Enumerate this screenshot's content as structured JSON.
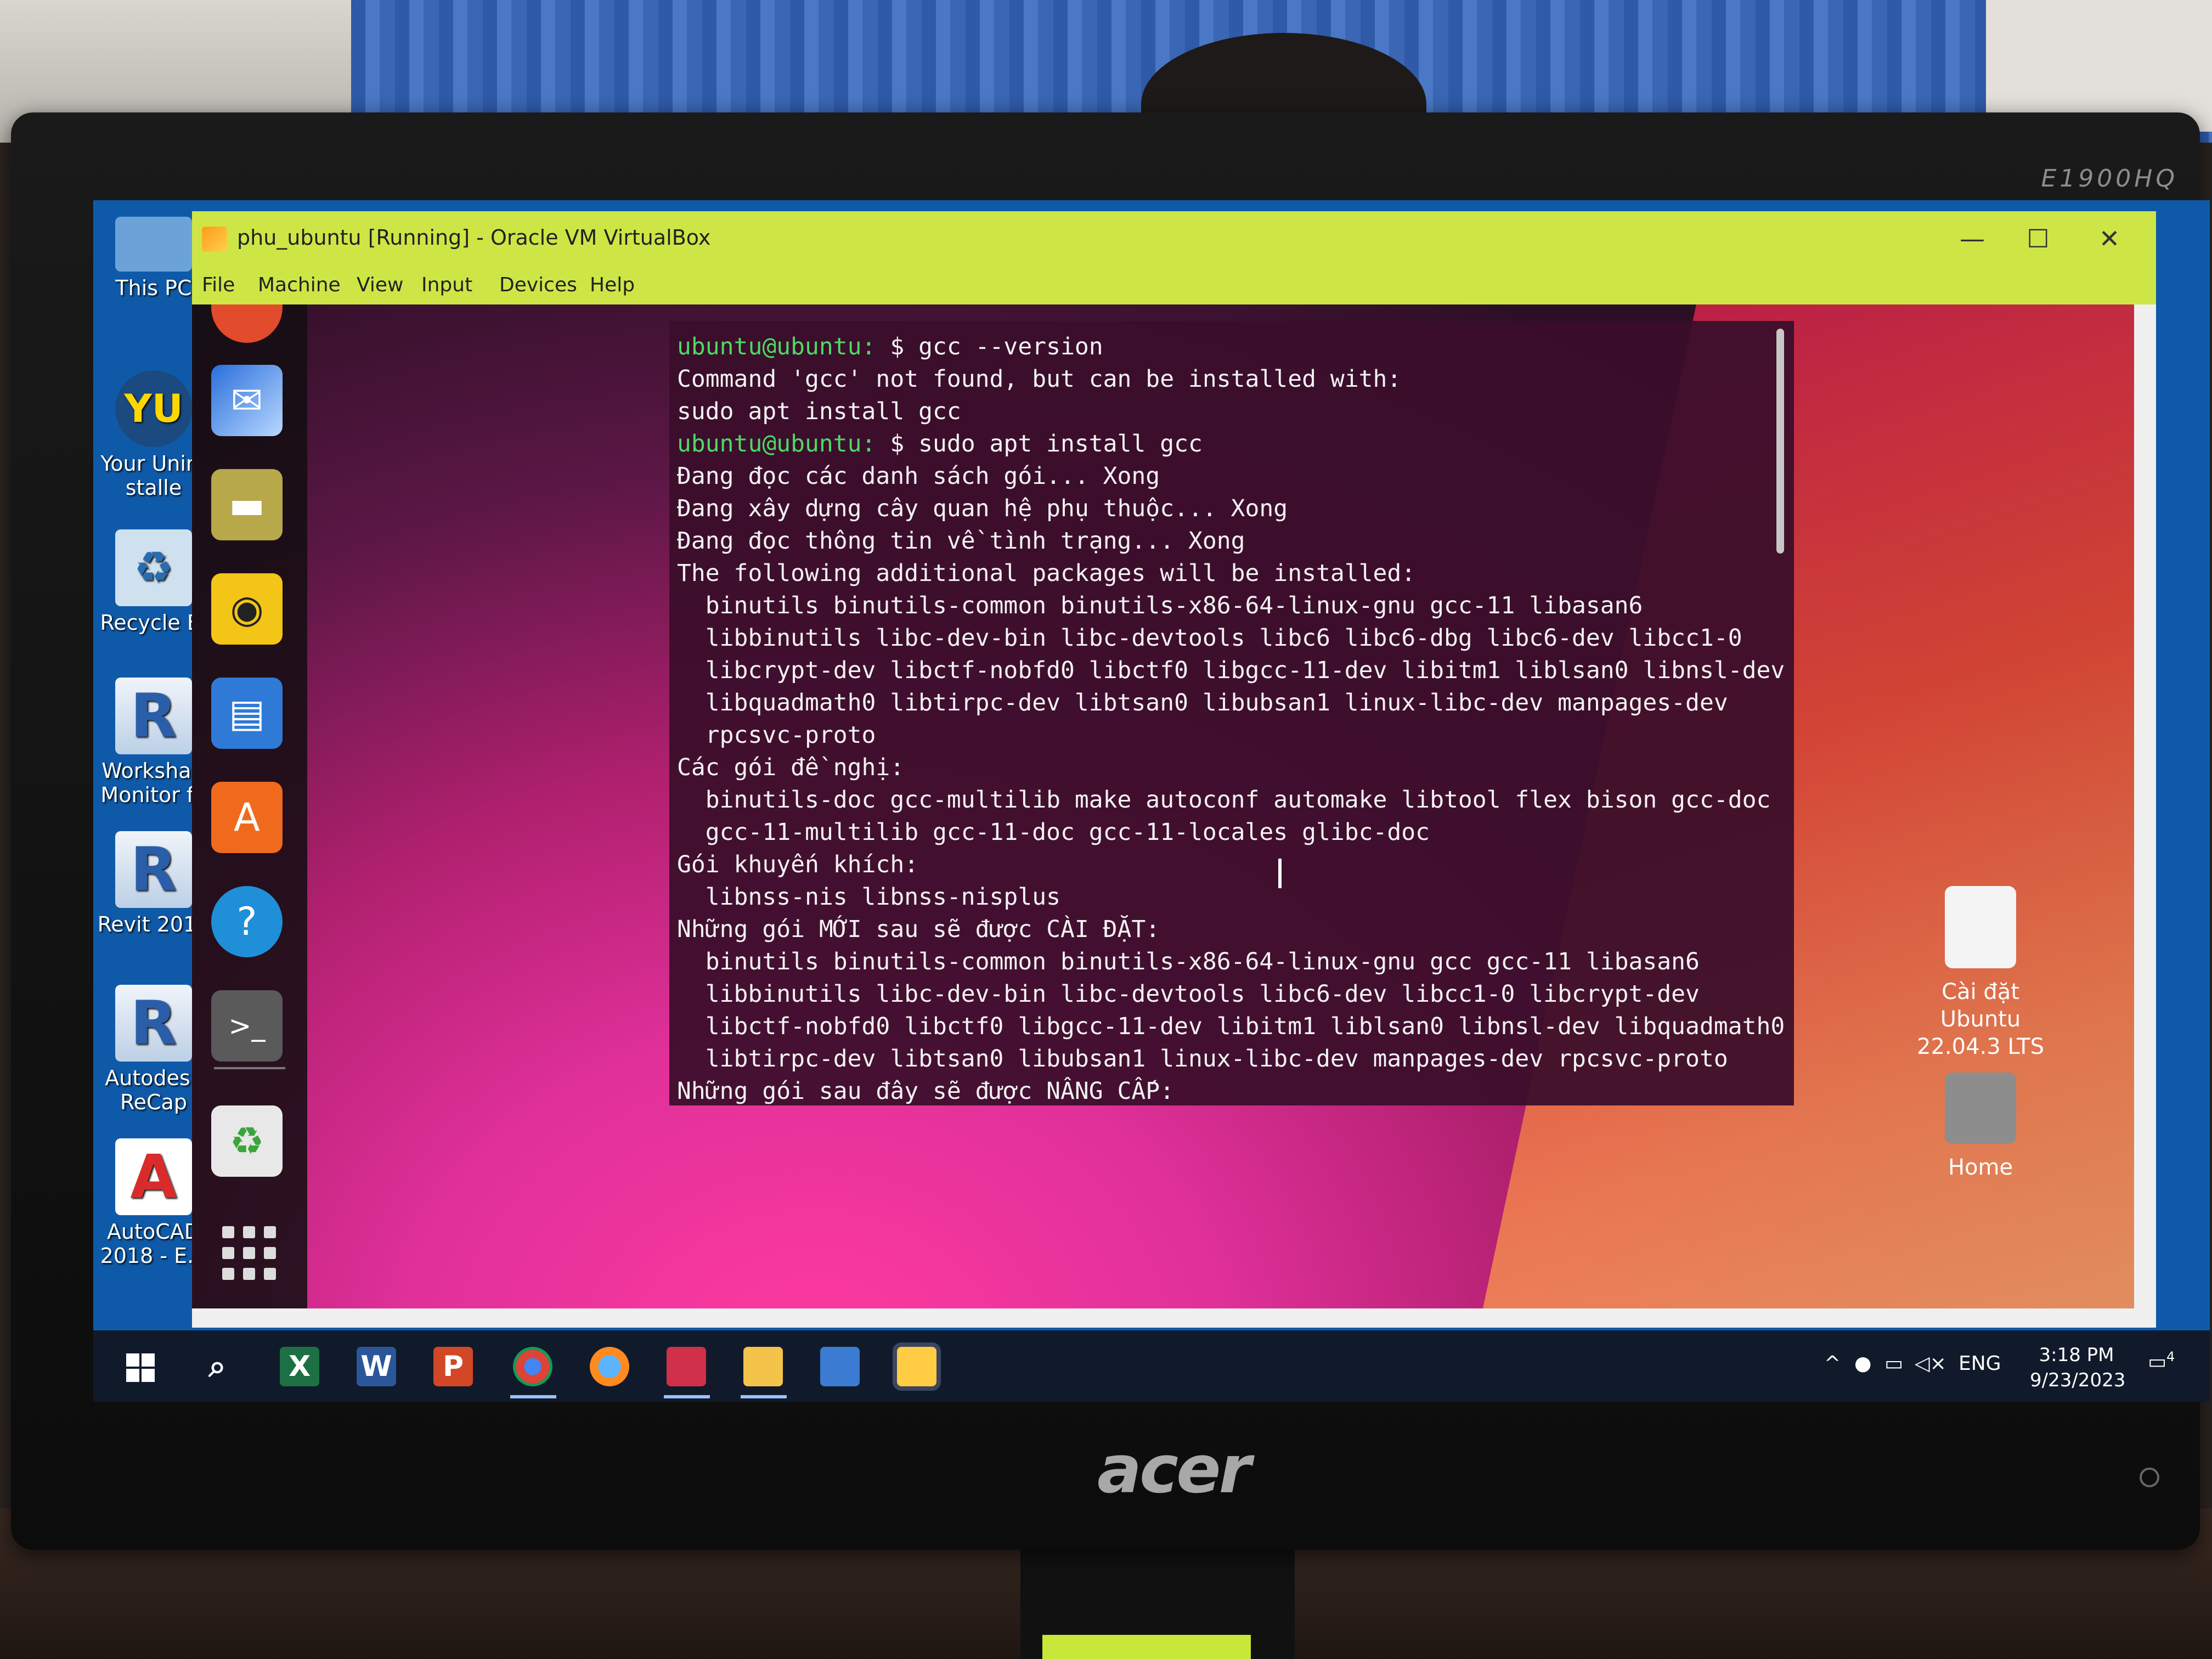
{
  "monitor": {
    "model_label": "E1900HQ",
    "brand": "acer"
  },
  "host_desktop": {
    "icons": [
      {
        "name": "this-pc",
        "label": "This PC"
      },
      {
        "name": "your-uninstaller",
        "label": "Your Unin-stalle"
      },
      {
        "name": "recycle-bin",
        "label": "Recycle Bi"
      },
      {
        "name": "worksharing-monitor",
        "label": "Workshari Monitor fo"
      },
      {
        "name": "revit-2019",
        "label": "Revit 2019"
      },
      {
        "name": "autodesk-recap",
        "label": "Autodesk ReCap"
      },
      {
        "name": "autocad-2018",
        "label": "AutoCAD 2018 - E..."
      }
    ]
  },
  "vbox_window": {
    "title": "phu_ubuntu [Running] - Oracle VM VirtualBox",
    "menu": [
      "File",
      "Machine",
      "View",
      "Input",
      "Devices",
      "Help"
    ],
    "controls": {
      "minimize": "—",
      "maximize": "☐",
      "close": "✕"
    }
  },
  "guest": {
    "dock_apps": [
      "chromium",
      "thunderbird-mail",
      "files",
      "rhythmbox",
      "libreoffice-writer",
      "ubuntu-software",
      "help",
      "terminal",
      "trash",
      "show-applications"
    ],
    "terminal": {
      "lines": [
        {
          "prompt": "ubuntu@ubuntu:",
          "text": " $ gcc --version"
        },
        {
          "prompt": "",
          "text": "Command 'gcc' not found, but can be installed with:"
        },
        {
          "prompt": "",
          "text": "sudo apt install gcc"
        },
        {
          "prompt": "ubuntu@ubuntu:",
          "text": " $ sudo apt install gcc"
        },
        {
          "prompt": "",
          "text": "Đang đọc các danh sách gói... Xong"
        },
        {
          "prompt": "",
          "text": "Đang xây dựng cây quan hệ phụ thuộc... Xong"
        },
        {
          "prompt": "",
          "text": "Đang đọc thông tin về tình trạng... Xong"
        },
        {
          "prompt": "",
          "text": "The following additional packages will be installed:"
        },
        {
          "prompt": "",
          "text": "  binutils binutils-common binutils-x86-64-linux-gnu gcc-11 libasan6"
        },
        {
          "prompt": "",
          "text": "  libbinutils libc-dev-bin libc-devtools libc6 libc6-dbg libc6-dev libcc1-0"
        },
        {
          "prompt": "",
          "text": "  libcrypt-dev libctf-nobfd0 libctf0 libgcc-11-dev libitm1 liblsan0 libnsl-dev"
        },
        {
          "prompt": "",
          "text": "  libquadmath0 libtirpc-dev libtsan0 libubsan1 linux-libc-dev manpages-dev"
        },
        {
          "prompt": "",
          "text": "  rpcsvc-proto"
        },
        {
          "prompt": "",
          "text": "Các gói đề nghị:"
        },
        {
          "prompt": "",
          "text": "  binutils-doc gcc-multilib make autoconf automake libtool flex bison gcc-doc"
        },
        {
          "prompt": "",
          "text": "  gcc-11-multilib gcc-11-doc gcc-11-locales glibc-doc"
        },
        {
          "prompt": "",
          "text": "Gói khuyến khích:"
        },
        {
          "prompt": "",
          "text": "  libnss-nis libnss-nisplus"
        },
        {
          "prompt": "",
          "text": "Những gói MỚI sau sẽ được CÀI ĐẶT:"
        },
        {
          "prompt": "",
          "text": "  binutils binutils-common binutils-x86-64-linux-gnu gcc gcc-11 libasan6"
        },
        {
          "prompt": "",
          "text": "  libbinutils libc-dev-bin libc-devtools libc6-dev libcc1-0 libcrypt-dev"
        },
        {
          "prompt": "",
          "text": "  libctf-nobfd0 libctf0 libgcc-11-dev libitm1 liblsan0 libnsl-dev libquadmath0"
        },
        {
          "prompt": "",
          "text": "  libtirpc-dev libtsan0 libubsan1 linux-libc-dev manpages-dev rpcsvc-proto"
        },
        {
          "prompt": "",
          "text": "Những gói sau đây sẽ được NÂNG CẤP:"
        }
      ]
    },
    "desktop_icons": {
      "installer": "Cài đặt Ubuntu 22.04.3 LTS",
      "home": "Home"
    }
  },
  "taskbar": {
    "apps": [
      "excel",
      "word",
      "powerpoint",
      "chrome",
      "firefox",
      "snipping",
      "file-explorer",
      "virtualbox-3d",
      "virtualbox"
    ],
    "language": "ENG",
    "time": "3:18 PM",
    "date": "9/23/2023",
    "notification_count": "4"
  }
}
